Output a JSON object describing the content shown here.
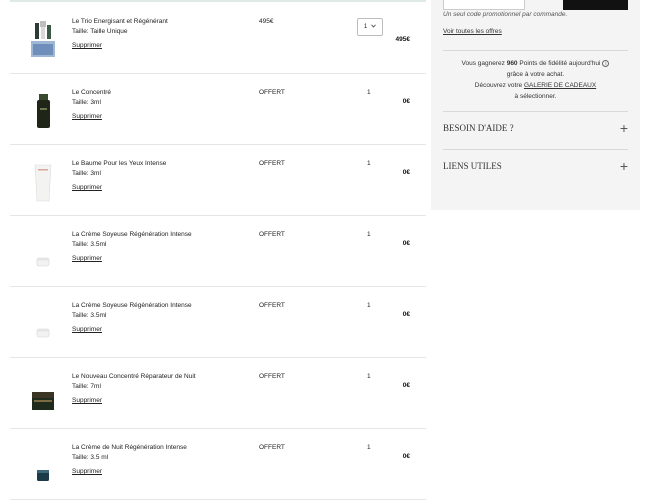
{
  "cart": {
    "items": [
      {
        "name": "Le Trio Energisant et Régénérant",
        "size": "Taille: Taille Unique",
        "remove": "Supprimer",
        "price": "495€",
        "qty": "1",
        "total": "495€",
        "thumb": "trio-set"
      },
      {
        "name": "Le Concentré",
        "size": "Taille: 3ml",
        "remove": "Supprimer",
        "price": "OFFERT",
        "qty": "1",
        "total": "0€",
        "thumb": "dark-tube"
      },
      {
        "name": "Le Baume Pour les Yeux Intense",
        "size": "Taille: 3ml",
        "remove": "Supprimer",
        "price": "OFFERT",
        "qty": "1",
        "total": "0€",
        "thumb": "white-tube"
      },
      {
        "name": "La Crème Soyeuse Régénération Intense",
        "size": "Taille: 3.5ml",
        "remove": "Supprimer",
        "price": "OFFERT",
        "qty": "1",
        "total": "0€",
        "thumb": "white-jar"
      },
      {
        "name": "La Crème Soyeuse Régénération Intense",
        "size": "Taille: 3.5ml",
        "remove": "Supprimer",
        "price": "OFFERT",
        "qty": "1",
        "total": "0€",
        "thumb": "white-jar"
      },
      {
        "name": "Le Nouveau Concentré Réparateur de Nuit",
        "size": "Taille: 7ml",
        "remove": "Supprimer",
        "price": "OFFERT",
        "qty": "1",
        "total": "0€",
        "thumb": "dark-jar"
      },
      {
        "name": "La Crème de Nuit Régénération Intense",
        "size": "Taille: 3.5 ml",
        "remove": "Supprimer",
        "price": "OFFERT",
        "qty": "1",
        "total": "0€",
        "thumb": "teal-jar"
      }
    ],
    "qty_select_value": "1"
  },
  "summary": {
    "promo_note": "Un seul code promotionnel par commande.",
    "offers_link": "Voir toutes les offres",
    "loyalty_pre": "Vous gagnerez ",
    "loyalty_points": "960",
    "loyalty_post": " Points de fidélité aujourd'hui",
    "loyalty_line2": "grâce à votre achat.",
    "gift_pre": "Découvrez votre ",
    "gift_link": "GALERIE DE CADEAUX",
    "gift_post": "à sélectionner.",
    "help_title": "BESOIN D'AIDE ?",
    "links_title": "LIENS UTILES",
    "plus": "+"
  },
  "colors": {
    "panel_bg": "#f4f4f4",
    "button_bg": "#111111",
    "top_accent": "#dfe9e6"
  }
}
